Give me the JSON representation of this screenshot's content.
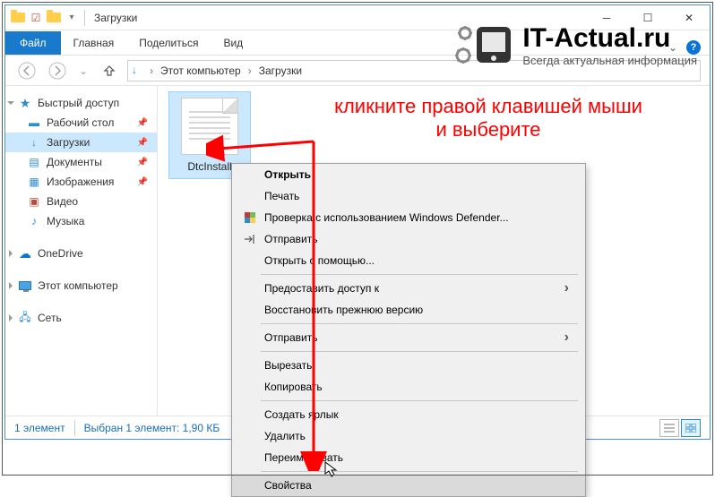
{
  "titlebar": {
    "title": "Загрузки"
  },
  "tabs": {
    "file": "Файл",
    "home": "Главная",
    "share": "Поделиться",
    "view": "Вид"
  },
  "address": {
    "crumb1": "Этот компьютер",
    "crumb2": "Загрузки"
  },
  "sidebar": {
    "quick": "Быстрый доступ",
    "items": [
      {
        "label": "Рабочий стол",
        "pinned": true
      },
      {
        "label": "Загрузки",
        "pinned": true,
        "selected": true
      },
      {
        "label": "Документы",
        "pinned": true
      },
      {
        "label": "Изображения",
        "pinned": true
      },
      {
        "label": "Видео",
        "pinned": false
      },
      {
        "label": "Музыка",
        "pinned": false
      }
    ],
    "onedrive": "OneDrive",
    "thispc": "Этот компьютер",
    "network": "Сеть"
  },
  "file": {
    "name": "DtcInstall"
  },
  "status": {
    "count": "1 элемент",
    "selected": "Выбран 1 элемент: 1,90 КБ"
  },
  "context": {
    "open": "Открыть",
    "print": "Печать",
    "defender": "Проверка с использованием Windows Defender...",
    "sendto_short": "Отправить",
    "openwith": "Открыть с помощью...",
    "grant": "Предоставить доступ к",
    "restore": "Восстановить прежнюю версию",
    "sendto": "Отправить",
    "cut": "Вырезать",
    "copy": "Копировать",
    "shortcut": "Создать ярлык",
    "delete": "Удалить",
    "rename": "Переименовать",
    "properties": "Свойства"
  },
  "annotation": {
    "line1": "кликните правой клавишей мыши",
    "line2": "и выберите"
  },
  "watermark": {
    "title": "IT-Actual.ru",
    "subtitle": "Всегда актуальная информация"
  }
}
